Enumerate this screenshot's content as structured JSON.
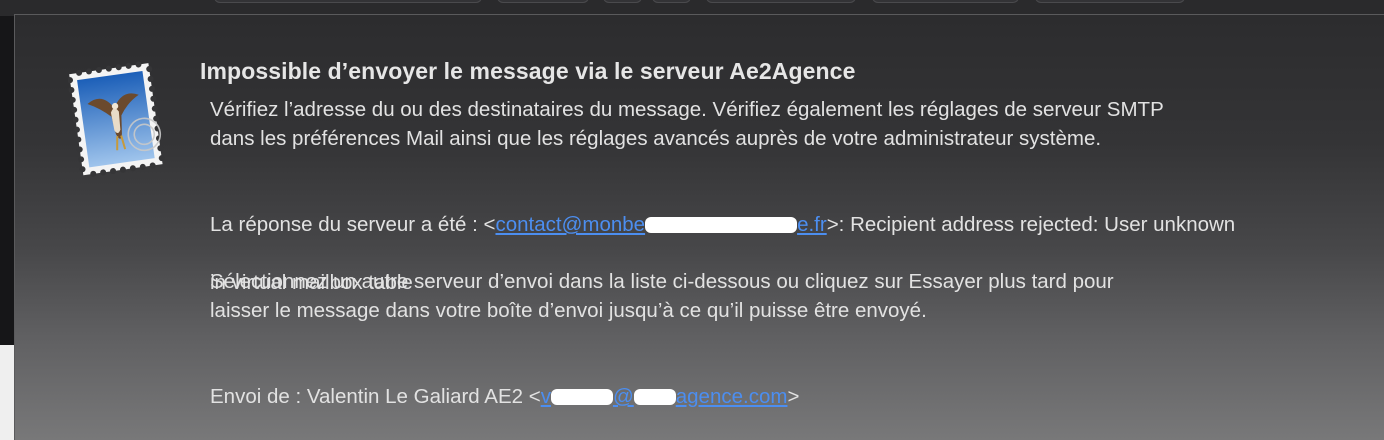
{
  "alert": {
    "title": "Impossible d’envoyer le message via le serveur Ae2Agence",
    "body_paragraph_1": "Vérifiez l’adresse du ou des destinataires du message. Vérifiez également les réglages de serveur SMTP\ndans les préférences Mail ainsi que les réglages avancés auprès de votre administrateur système.",
    "server_response": {
      "prefix": "La réponse du serveur a été : <",
      "email_visible_start": "contact@monbe",
      "email_visible_end": "e.fr",
      "suffix": ">: Recipient address rejected: User unknown",
      "line2": "in virtual mailbox table"
    },
    "body_paragraph_3": "Sélectionnez un autre serveur d’envoi dans la liste ci-dessous ou cliquez sur Essayer plus tard pour\nlaisser le message dans votre boîte d’envoi jusqu’à ce qu’il puisse être envoyé.",
    "sender": {
      "prefix": "Envoi de : Valentin Le Galiard AE2 <",
      "email_visible_start": "v",
      "email_visible_mid": "@",
      "email_visible_end": "agence.com",
      "suffix": ">"
    }
  },
  "icon": {
    "name": "mail-stamp-icon"
  },
  "colors": {
    "link": "#4c8ef0",
    "text": "#e2e2e2",
    "title": "#e6e6e6"
  }
}
